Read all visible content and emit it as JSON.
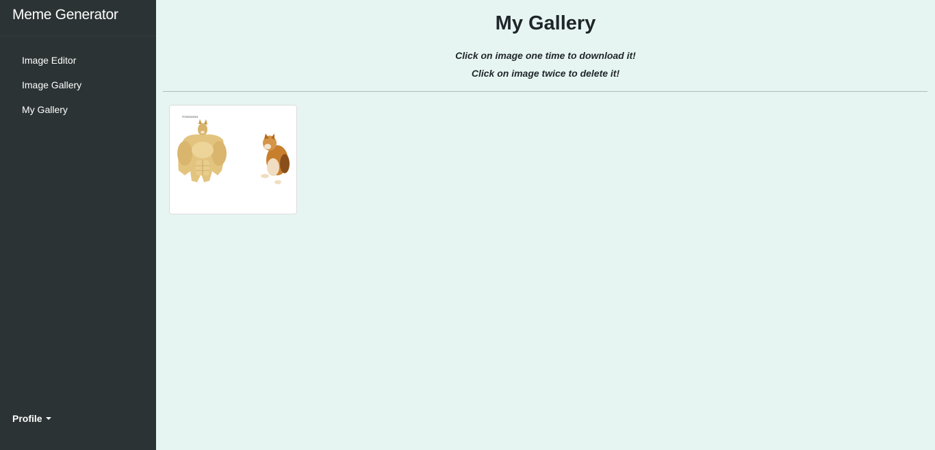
{
  "sidebar": {
    "brand": "Meme Generator",
    "items": [
      {
        "label": "Image Editor"
      },
      {
        "label": "Image Gallery"
      },
      {
        "label": "My Gallery"
      }
    ],
    "profile_label": "Profile"
  },
  "main": {
    "title": "My Gallery",
    "hint_download": "Click on image one time to download it!",
    "hint_delete": "Click on image twice to delete it!"
  },
  "colors": {
    "sidebar_bg": "#2c3334",
    "page_bg": "#e6f5f2",
    "text_dark": "#1f2529"
  },
  "gallery": {
    "items": [
      {
        "caption": "maaaaaa"
      }
    ]
  },
  "icons": {
    "profile_caret": "caret-down-icon"
  }
}
